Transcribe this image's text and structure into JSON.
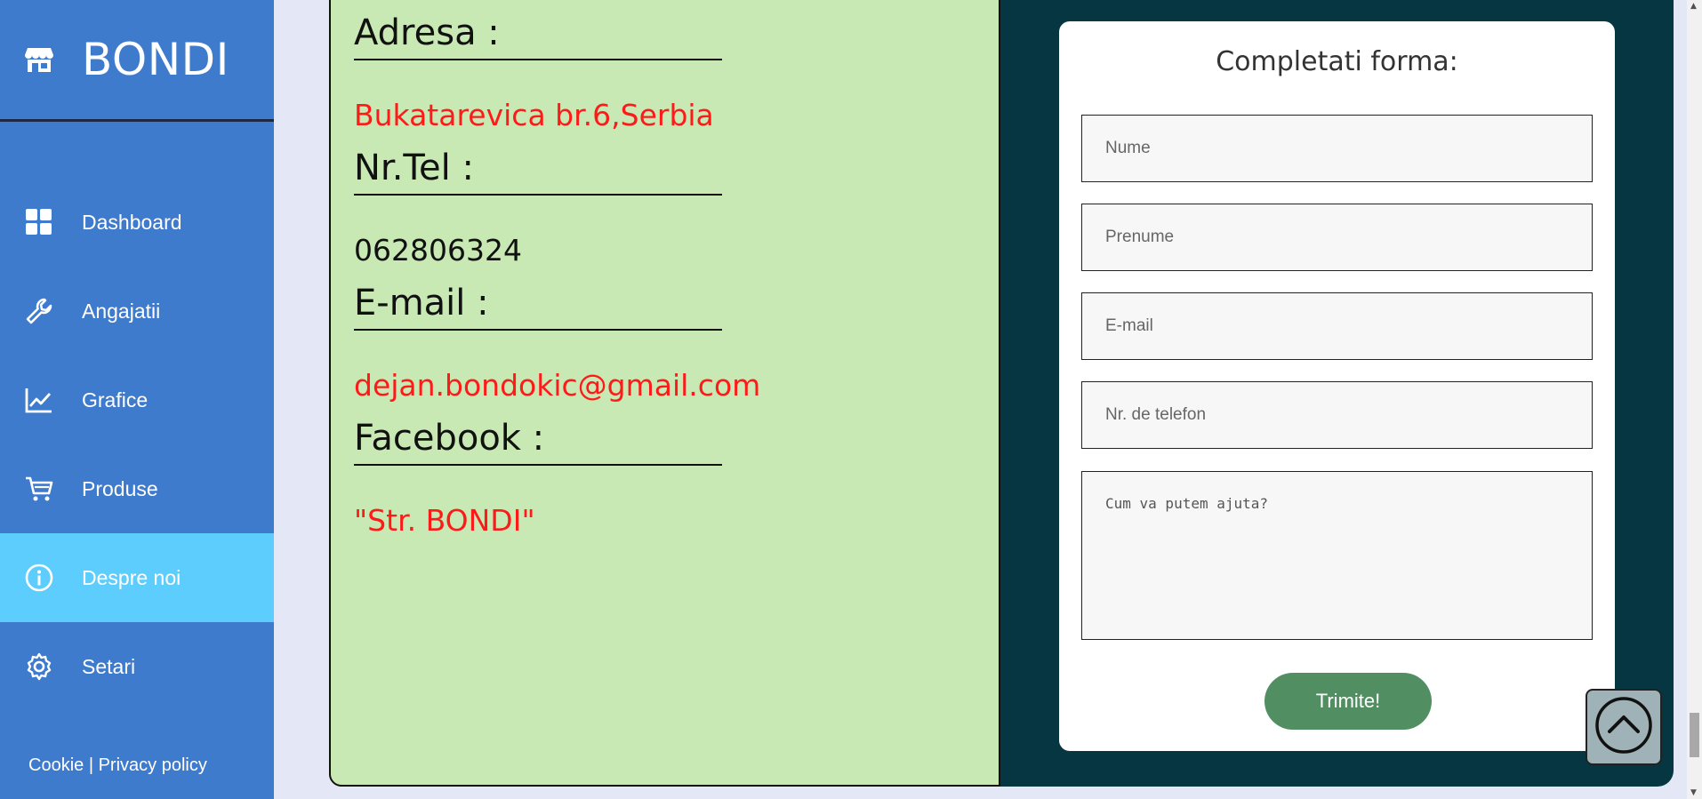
{
  "sidebar": {
    "brand": "BONDI",
    "items": [
      {
        "label": "Dashboard",
        "icon": "dashboard-icon"
      },
      {
        "label": "Angajatii",
        "icon": "wrench-icon"
      },
      {
        "label": "Grafice",
        "icon": "chart-line-icon"
      },
      {
        "label": "Produse",
        "icon": "cart-icon"
      },
      {
        "label": "Despre noi",
        "icon": "info-icon",
        "active": true
      },
      {
        "label": "Setari",
        "icon": "gear-icon"
      }
    ],
    "footer": {
      "cookie": "Cookie",
      "separator": "|",
      "privacy": "Privacy policy"
    }
  },
  "contact": {
    "address_label": "Adresa :",
    "address_value": "Bukatarevica br.6,Serbia",
    "phone_label": "Nr.Tel :",
    "phone_value": "062806324",
    "email_label": "E-mail :",
    "email_value": "dejan.bondokic@gmail.com",
    "facebook_label": "Facebook :",
    "facebook_value": "\"Str. BONDI\""
  },
  "form": {
    "title": "Completati forma:",
    "name_placeholder": "Nume",
    "surname_placeholder": "Prenume",
    "email_placeholder": "E-mail",
    "phone_placeholder": "Nr. de telefon",
    "message_placeholder": "Cum va putem ajuta?",
    "submit_label": "Trimite!"
  },
  "colors": {
    "sidebar": "#3f7bcd",
    "active_item": "#5dcdfd",
    "contact_panel": "#c8e9b3",
    "main_background": "#063641",
    "highlight_text": "#ff1a1a",
    "submit": "#518f62"
  }
}
